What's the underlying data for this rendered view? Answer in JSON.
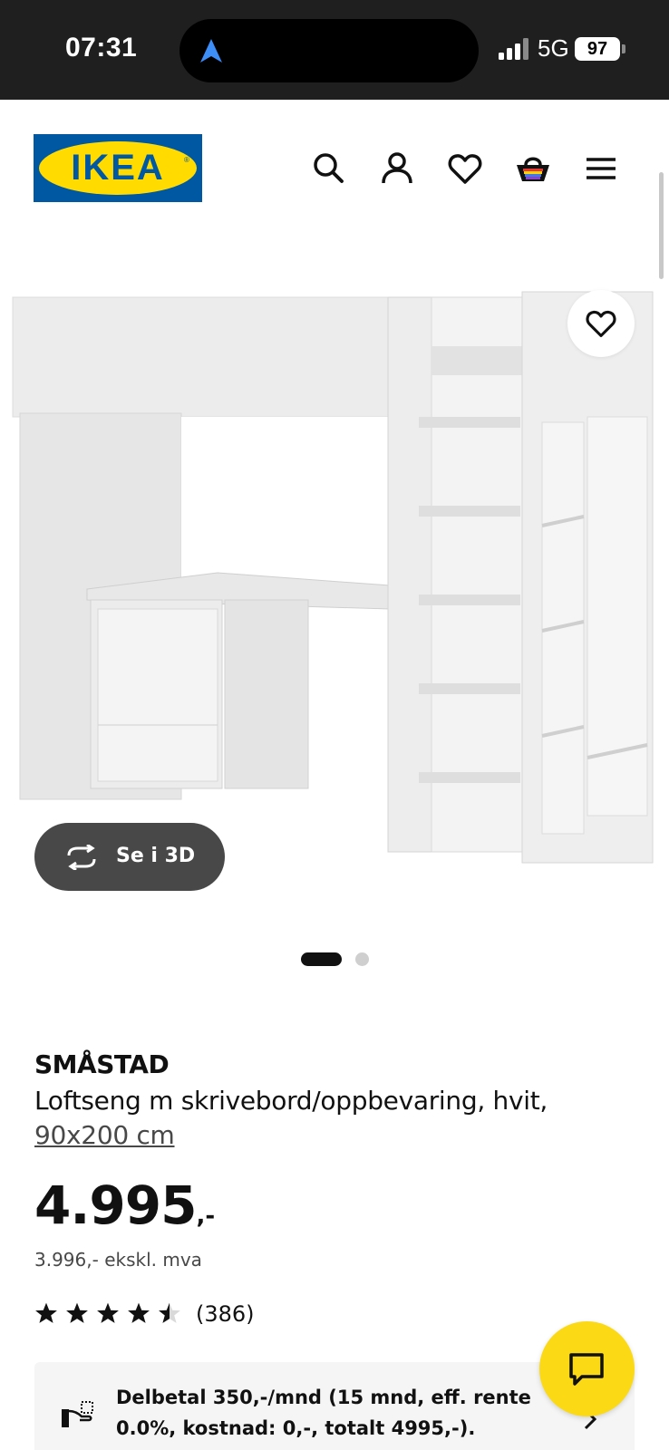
{
  "status_bar": {
    "time": "07:31",
    "network": "5G",
    "battery": "97"
  },
  "header": {
    "logo_text": "IKEA",
    "icons": [
      "search-icon",
      "account-icon",
      "wishlist-icon",
      "basket-icon",
      "menu-icon"
    ]
  },
  "gallery": {
    "view_3d_label": "Se i 3D",
    "dots": 2,
    "active_dot": 1
  },
  "product": {
    "name": "SMÅSTAD",
    "description": "Loftseng m skrivebord/oppbevaring, hvit,",
    "size": "90x200 cm",
    "price": "4.995",
    "price_suffix": ",-",
    "price_excl_vat": "3.996,- ekskl. mva",
    "rating": 4.5,
    "review_count": "(386)"
  },
  "payment": {
    "text": "Delbetal 350,-/mnd (15 mnd, eff. rente 0.0%, kostnad: 0,-, totalt 4995,-)."
  },
  "colors": {
    "ikea_blue": "#0058a3",
    "ikea_yellow": "#ffdb00",
    "chat_yellow": "#fbd914",
    "button_dark": "#484848"
  }
}
